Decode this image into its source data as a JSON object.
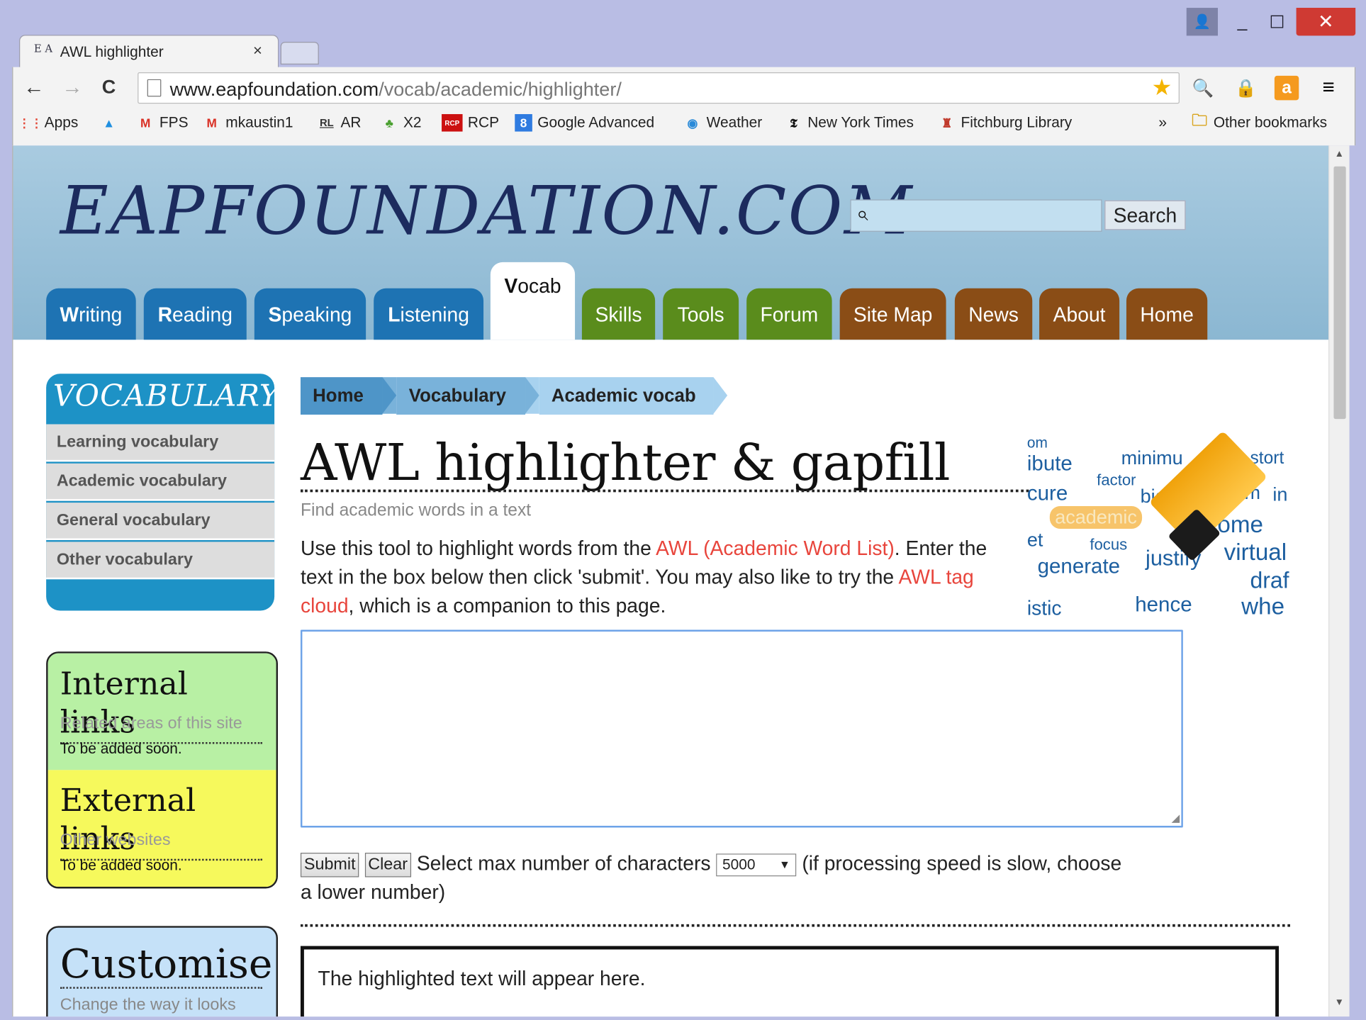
{
  "window": {
    "controls": {
      "user": "👤",
      "minimize": "_",
      "maximize": "☐",
      "close": "✕"
    }
  },
  "tab": {
    "icon": "E A",
    "title": "AWL highlighter",
    "close": "×"
  },
  "toolbar": {
    "back": "←",
    "forward": "→",
    "reload": "C",
    "url_host": "www.eapfoundation.com",
    "url_path": "/vocab/academic/highlighter/",
    "star": "★",
    "extensions": [
      "🔍",
      "🔒",
      "a",
      "≡"
    ]
  },
  "bookmarks": {
    "items": [
      {
        "icon": "⋮⋮",
        "label": "Apps",
        "color": "#e34a3a"
      },
      {
        "icon": "▲",
        "label": "",
        "color": "#1f8fe0"
      },
      {
        "icon": "M",
        "label": "FPS",
        "color": "#d93025"
      },
      {
        "icon": "M",
        "label": "mkaustin1",
        "color": "#d93025"
      },
      {
        "icon": "RL",
        "label": "AR",
        "color": "#333333"
      },
      {
        "icon": "♣",
        "label": "X2",
        "color": "#4aa030"
      },
      {
        "icon": "RCP",
        "label": "RCP",
        "color": "#cc1111"
      },
      {
        "icon": "8",
        "label": "Google Advanced",
        "color": "#2f7be0"
      },
      {
        "icon": "◉",
        "label": "Weather",
        "color": "#2a8ad8"
      },
      {
        "icon": "𝕿",
        "label": "New York Times",
        "color": "#111111"
      },
      {
        "icon": "♜",
        "label": "Fitchburg Library",
        "color": "#c0392b"
      }
    ],
    "more": "»",
    "other": "Other bookmarks"
  },
  "site": {
    "logo": "EAPFOUNDATION.COM",
    "search_button": "Search",
    "search_value": "",
    "nav": [
      {
        "first": "W",
        "rest": "riting"
      },
      {
        "first": "R",
        "rest": "eading"
      },
      {
        "first": "S",
        "rest": "peaking"
      },
      {
        "first": "L",
        "rest": "istening"
      },
      {
        "first": "V",
        "rest": "ocab"
      },
      {
        "first": "",
        "rest": "Skills"
      },
      {
        "first": "",
        "rest": "Tools"
      },
      {
        "first": "",
        "rest": "Forum"
      },
      {
        "first": "",
        "rest": "Site Map"
      },
      {
        "first": "",
        "rest": "News"
      },
      {
        "first": "",
        "rest": "About"
      },
      {
        "first": "",
        "rest": "Home"
      }
    ]
  },
  "sidebar": {
    "vocab_title": "VOCABULARY",
    "vocab_items": [
      "Learning vocabulary",
      "Academic vocabulary",
      "General vocabulary",
      "Other vocabulary"
    ],
    "internal": {
      "title": "Internal links",
      "sub": "Related areas of this site",
      "text": "To be added soon."
    },
    "external": {
      "title": "External links",
      "sub": "Other websites",
      "text": "To be added soon."
    },
    "customise": {
      "title": "Customise",
      "sub": "Change the way it looks"
    }
  },
  "main": {
    "breadcrumbs": [
      "Home",
      "Vocabulary",
      "Academic vocab"
    ],
    "title": "AWL highlighter & gapfill",
    "subtitle": "Find academic words in a text",
    "intro_1": "Use this tool to highlight words from the ",
    "intro_link1": "AWL (Academic Word List)",
    "intro_2": ". Enter the text in the box below then click 'submit'. You may also like to try the ",
    "intro_link2": "AWL tag cloud",
    "intro_3": ", which is a companion to this page.",
    "cloud_words": [
      "om",
      "ibute",
      "minimu",
      "stort",
      "factor",
      "cure",
      "bia",
      "orm",
      "in",
      "academic",
      "income",
      "et",
      "focus",
      "virtual",
      "generate",
      "justify",
      "draf",
      "istic",
      "hence",
      "whe"
    ],
    "submit": "Submit",
    "clear": "Clear",
    "controls_text_1": " Select max number of characters ",
    "max_chars": "5000",
    "controls_text_2": " (if processing speed is slow, choose a lower number)",
    "output_placeholder": "The highlighted text will appear here."
  }
}
